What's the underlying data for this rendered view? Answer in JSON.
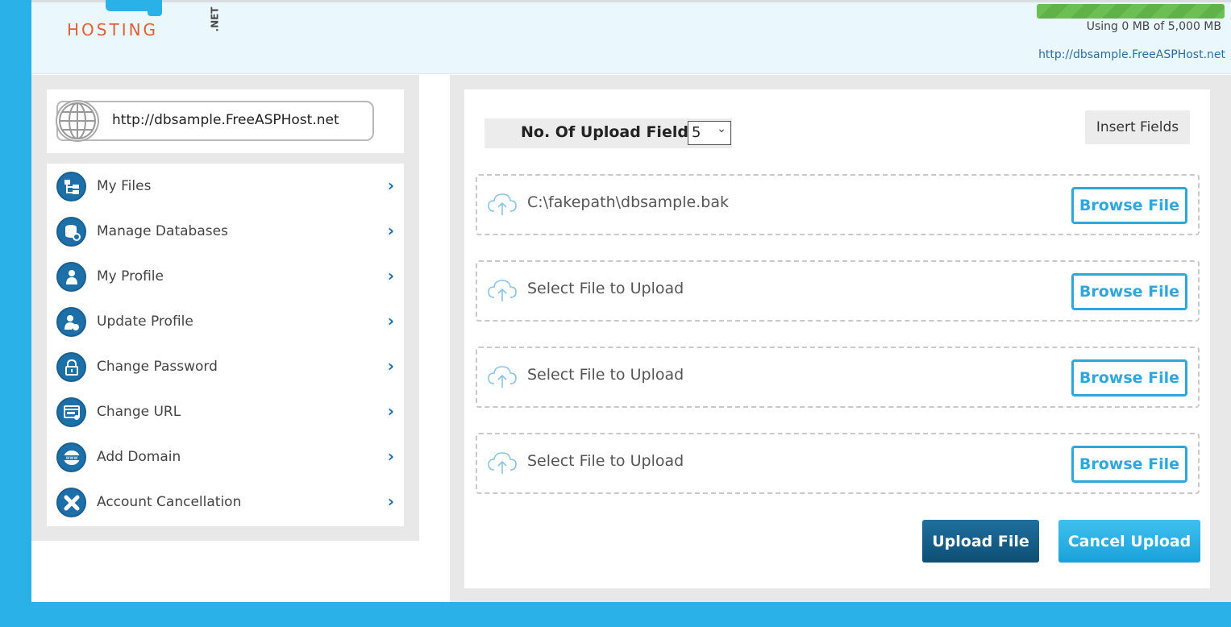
{
  "header": {
    "logo_word": "HOSTING",
    "logo_suffix": ".NET",
    "quota_text": "Using 0 MB of 5,000 MB",
    "quota_fraction": 1.0,
    "site_url": "http://dbsample.FreeASPHost.net"
  },
  "sidebar": {
    "site_url": "http://dbsample.FreeASPHost.net",
    "items": [
      {
        "label": "My Files",
        "icon": "folder-tree-icon"
      },
      {
        "label": "Manage Databases",
        "icon": "database-icon"
      },
      {
        "label": "My Profile",
        "icon": "user-icon"
      },
      {
        "label": "Update Profile",
        "icon": "user-edit-icon"
      },
      {
        "label": "Change Password",
        "icon": "lock-icon"
      },
      {
        "label": "Change URL",
        "icon": "url-icon"
      },
      {
        "label": "Add Domain",
        "icon": "www-icon"
      },
      {
        "label": "Account Cancellation",
        "icon": "close-icon"
      }
    ]
  },
  "upload": {
    "fields_label": "No. Of Upload Fields",
    "fields_value": "5",
    "insert_label": "Insert Fields",
    "browse_label": "Browse File",
    "rows": [
      {
        "text": "C:\\fakepath\\dbsample.bak"
      },
      {
        "text": "Select File to Upload"
      },
      {
        "text": "Select File to Upload"
      },
      {
        "text": "Select File to Upload"
      }
    ],
    "upload_label": "Upload File",
    "cancel_label": "Cancel Upload"
  },
  "colors": {
    "brand_blue": "#29b1e8",
    "dark_blue": "#1d6fa8",
    "quota_green": "#6cbf52",
    "logo_orange": "#e0603a"
  }
}
